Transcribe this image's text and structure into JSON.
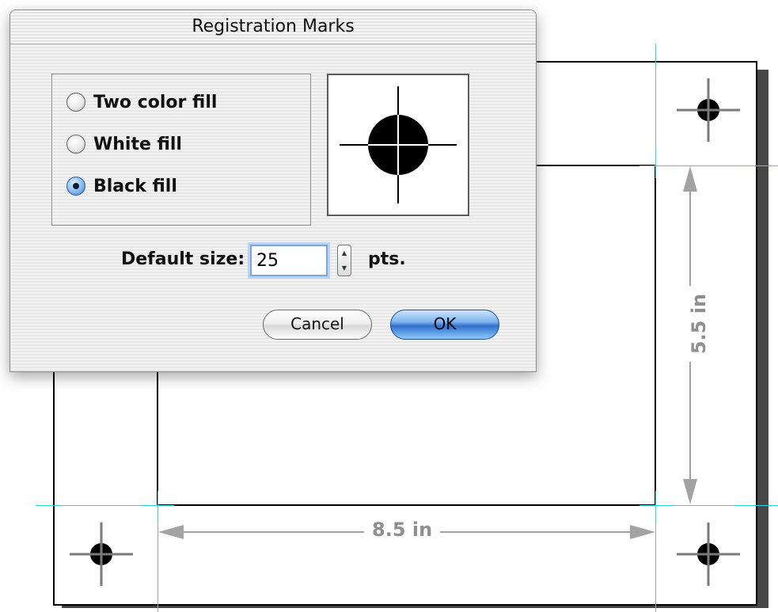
{
  "dialog": {
    "title": "Registration Marks",
    "fill_options": [
      {
        "label": "Two color fill",
        "selected": false
      },
      {
        "label": "White fill",
        "selected": false
      },
      {
        "label": "Black fill",
        "selected": true
      }
    ],
    "default_size_label": "Default size:",
    "default_size_value": "25",
    "units_label": "pts.",
    "cancel_label": "Cancel",
    "ok_label": "OK"
  },
  "diagram": {
    "width_label": "8.5 in",
    "height_label": "5.5 in"
  },
  "colors": {
    "guide_cyan": "#23d8e0",
    "dimension_gray": "#8f8f8f",
    "ok_button_blue": "#2e71cc"
  }
}
